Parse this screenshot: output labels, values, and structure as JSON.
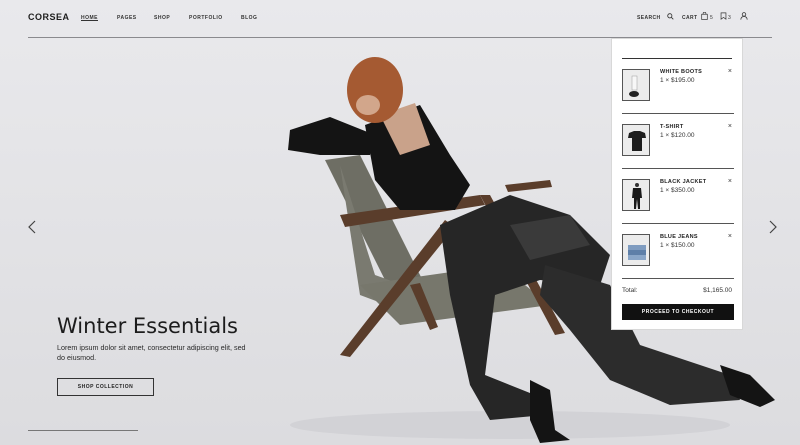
{
  "header": {
    "logo": "CORSEA",
    "nav": [
      "HOME",
      "PAGES",
      "SHOP",
      "PORTFOLIO",
      "BLOG"
    ],
    "search_label": "SEARCH",
    "cart_label": "CART",
    "cart_count": "5",
    "wishlist_count": "3",
    "icons": [
      "search-icon",
      "bag-icon",
      "bookmark-icon",
      "user-icon"
    ]
  },
  "hero": {
    "title": "Winter Essentials",
    "description": "Lorem ipsum dolor sit amet, consectetur adipiscing elit, sed do eiusmod.",
    "button": "SHOP COLLECTION",
    "icons": [
      "chevron-left-icon",
      "chevron-right-icon"
    ]
  },
  "cart": {
    "items": [
      {
        "name": "WHITE BOOTS",
        "qty": "1 × $195.00",
        "remove": "×"
      },
      {
        "name": "T-SHIRT",
        "qty": "1 × $120.00",
        "remove": "×"
      },
      {
        "name": "BLACK JACKET",
        "qty": "1 × $350.00",
        "remove": "×"
      },
      {
        "name": "BLUE JEANS",
        "qty": "1 × $150.00",
        "remove": "×"
      }
    ],
    "total_label": "Total:",
    "total_value": "$1,165.00",
    "checkout_button": "PROCEED TO CHECKOUT"
  },
  "colors": {
    "background": "#e4e4e7",
    "checkout_button": "#111111",
    "panel": "#ffffff"
  }
}
